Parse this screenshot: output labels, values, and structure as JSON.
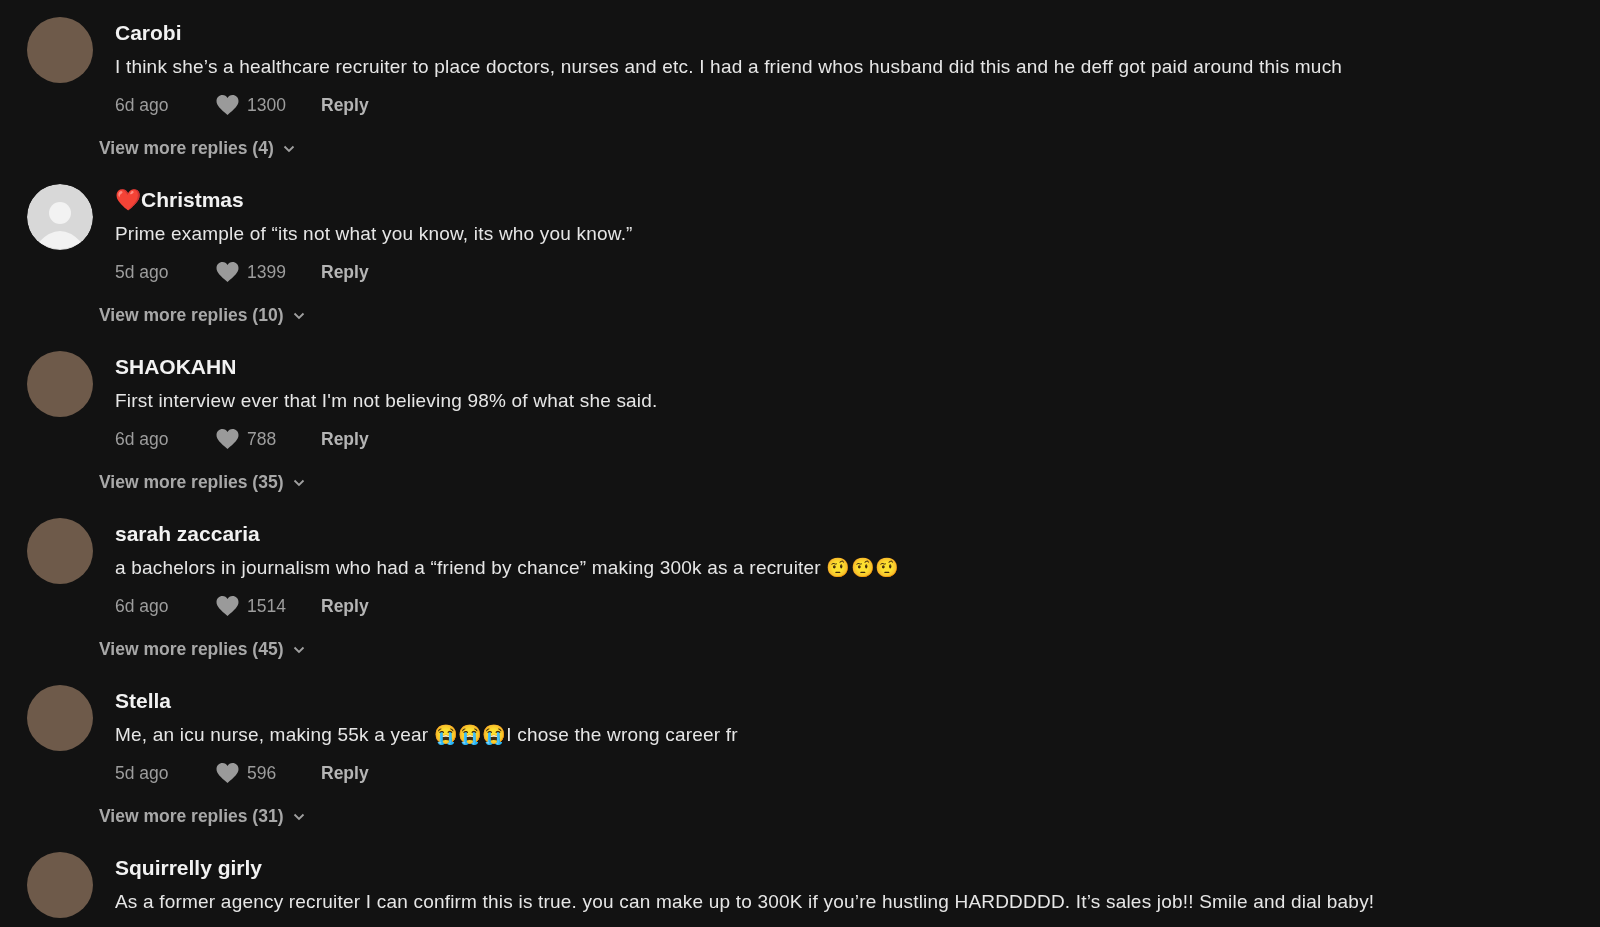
{
  "comments": [
    {
      "avatar": {
        "kind": "photo"
      },
      "name": "Carobi",
      "text": "I think she’s a healthcare recruiter to place doctors, nurses and etc. I had a friend whos husband did this and he deff got paid around this much",
      "time": "6d ago",
      "likes": "1300",
      "reply": "Reply",
      "more": "View more replies (4)"
    },
    {
      "avatar": {
        "kind": "default"
      },
      "name": "❤️Christmas",
      "text": "Prime example of “its not what you know, its who you know.”",
      "time": "5d ago",
      "likes": "1399",
      "reply": "Reply",
      "more": "View more replies (10)"
    },
    {
      "avatar": {
        "kind": "photo"
      },
      "name": "SHAOKAHN",
      "text": "First interview ever that I'm not believing 98% of what she said.",
      "time": "6d ago",
      "likes": "788",
      "reply": "Reply",
      "more": "View more replies (35)"
    },
    {
      "avatar": {
        "kind": "photo"
      },
      "name": "sarah zaccaria",
      "text": "a bachelors in journalism who had a “friend by chance” making 300k as a recruiter 🤨🤨🤨",
      "time": "6d ago",
      "likes": "1514",
      "reply": "Reply",
      "more": "View more replies (45)"
    },
    {
      "avatar": {
        "kind": "photo"
      },
      "name": "Stella",
      "text": "Me, an icu nurse, making 55k a year 😭😭😭I chose the wrong career fr",
      "time": "5d ago",
      "likes": "596",
      "reply": "Reply",
      "more": "View more replies (31)"
    },
    {
      "avatar": {
        "kind": "photo"
      },
      "name": "Squirrelly girly",
      "text": "As a former agency recruiter I can confirm this is true. you can make up to 300K if you’re hustling HARDDDDD. It’s sales job!! Smile and dial baby!"
    }
  ]
}
